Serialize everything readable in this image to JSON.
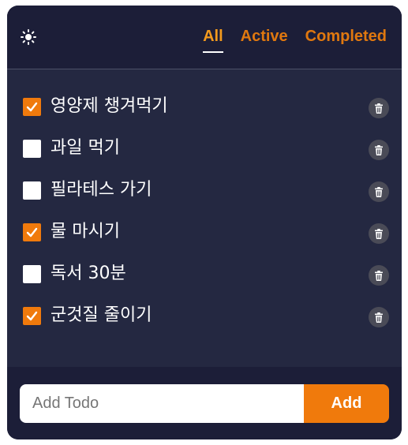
{
  "header": {
    "theme_toggle_icon": "sun-icon",
    "filters": [
      {
        "label": "All",
        "selected": true
      },
      {
        "label": "Active",
        "selected": false
      },
      {
        "label": "Completed",
        "selected": false
      }
    ]
  },
  "todos": [
    {
      "text": "영양제 챙겨먹기",
      "completed": true
    },
    {
      "text": "과일 먹기",
      "completed": false
    },
    {
      "text": "필라테스 가기",
      "completed": false
    },
    {
      "text": "물 마시기",
      "completed": true
    },
    {
      "text": "독서 30분",
      "completed": false
    },
    {
      "text": "군것질 줄이기",
      "completed": true
    }
  ],
  "add_form": {
    "placeholder": "Add Todo",
    "value": "",
    "button_label": "Add"
  },
  "colors": {
    "accent": "#f07a0c",
    "header_bg": "#1c1e38",
    "body_bg": "#242841",
    "delete_bg": "#4a4b57"
  }
}
